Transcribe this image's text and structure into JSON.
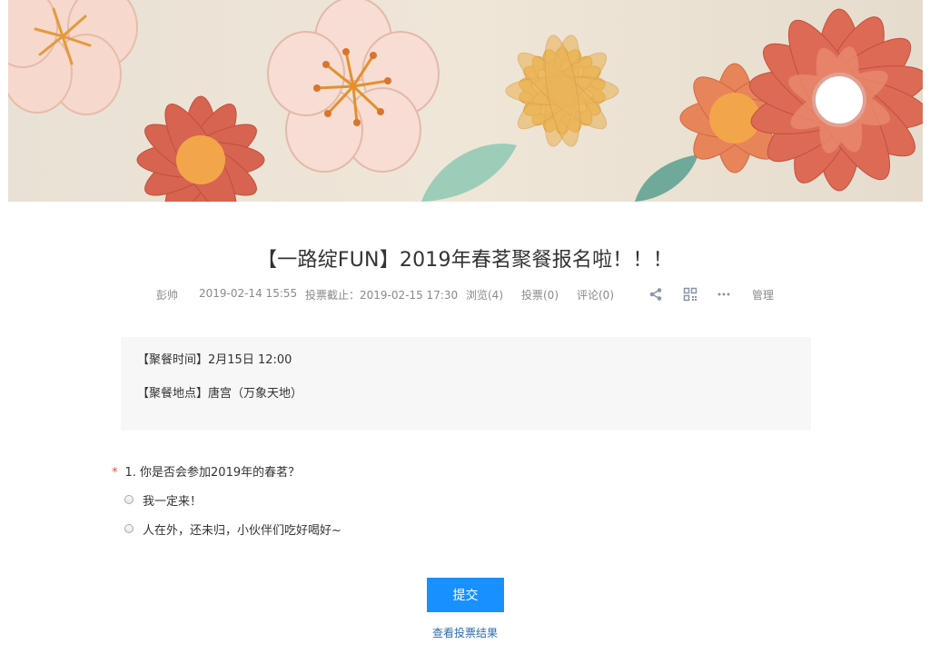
{
  "page": {
    "title": "【一路绽FUN】2019年春茗聚餐报名啦！！！"
  },
  "meta": {
    "author": "彭帅",
    "published": "2019-02-14 15:55",
    "deadline": "投票截止：2019-02-15 17:30",
    "views": "浏览(4)",
    "votes": "投票(0)",
    "comments": "评论(0)",
    "manage": "管理",
    "icons": [
      "share-icon",
      "qrcode-icon",
      "more-icon"
    ]
  },
  "info": {
    "time_line": "【聚餐时间】2月15日 12:00",
    "place_line": "【聚餐地点】唐宫（万象天地）"
  },
  "question": {
    "required_mark": "*",
    "text": "1. 你是否会参加2019年的春茗？",
    "options": [
      "我一定来！",
      "人在外，还未归，小伙伴们吃好喝好~"
    ]
  },
  "actions": {
    "submit": "提交",
    "view_results": "查看投票结果"
  },
  "colors": {
    "accent": "#1890ff",
    "required": "#e74c3c"
  }
}
